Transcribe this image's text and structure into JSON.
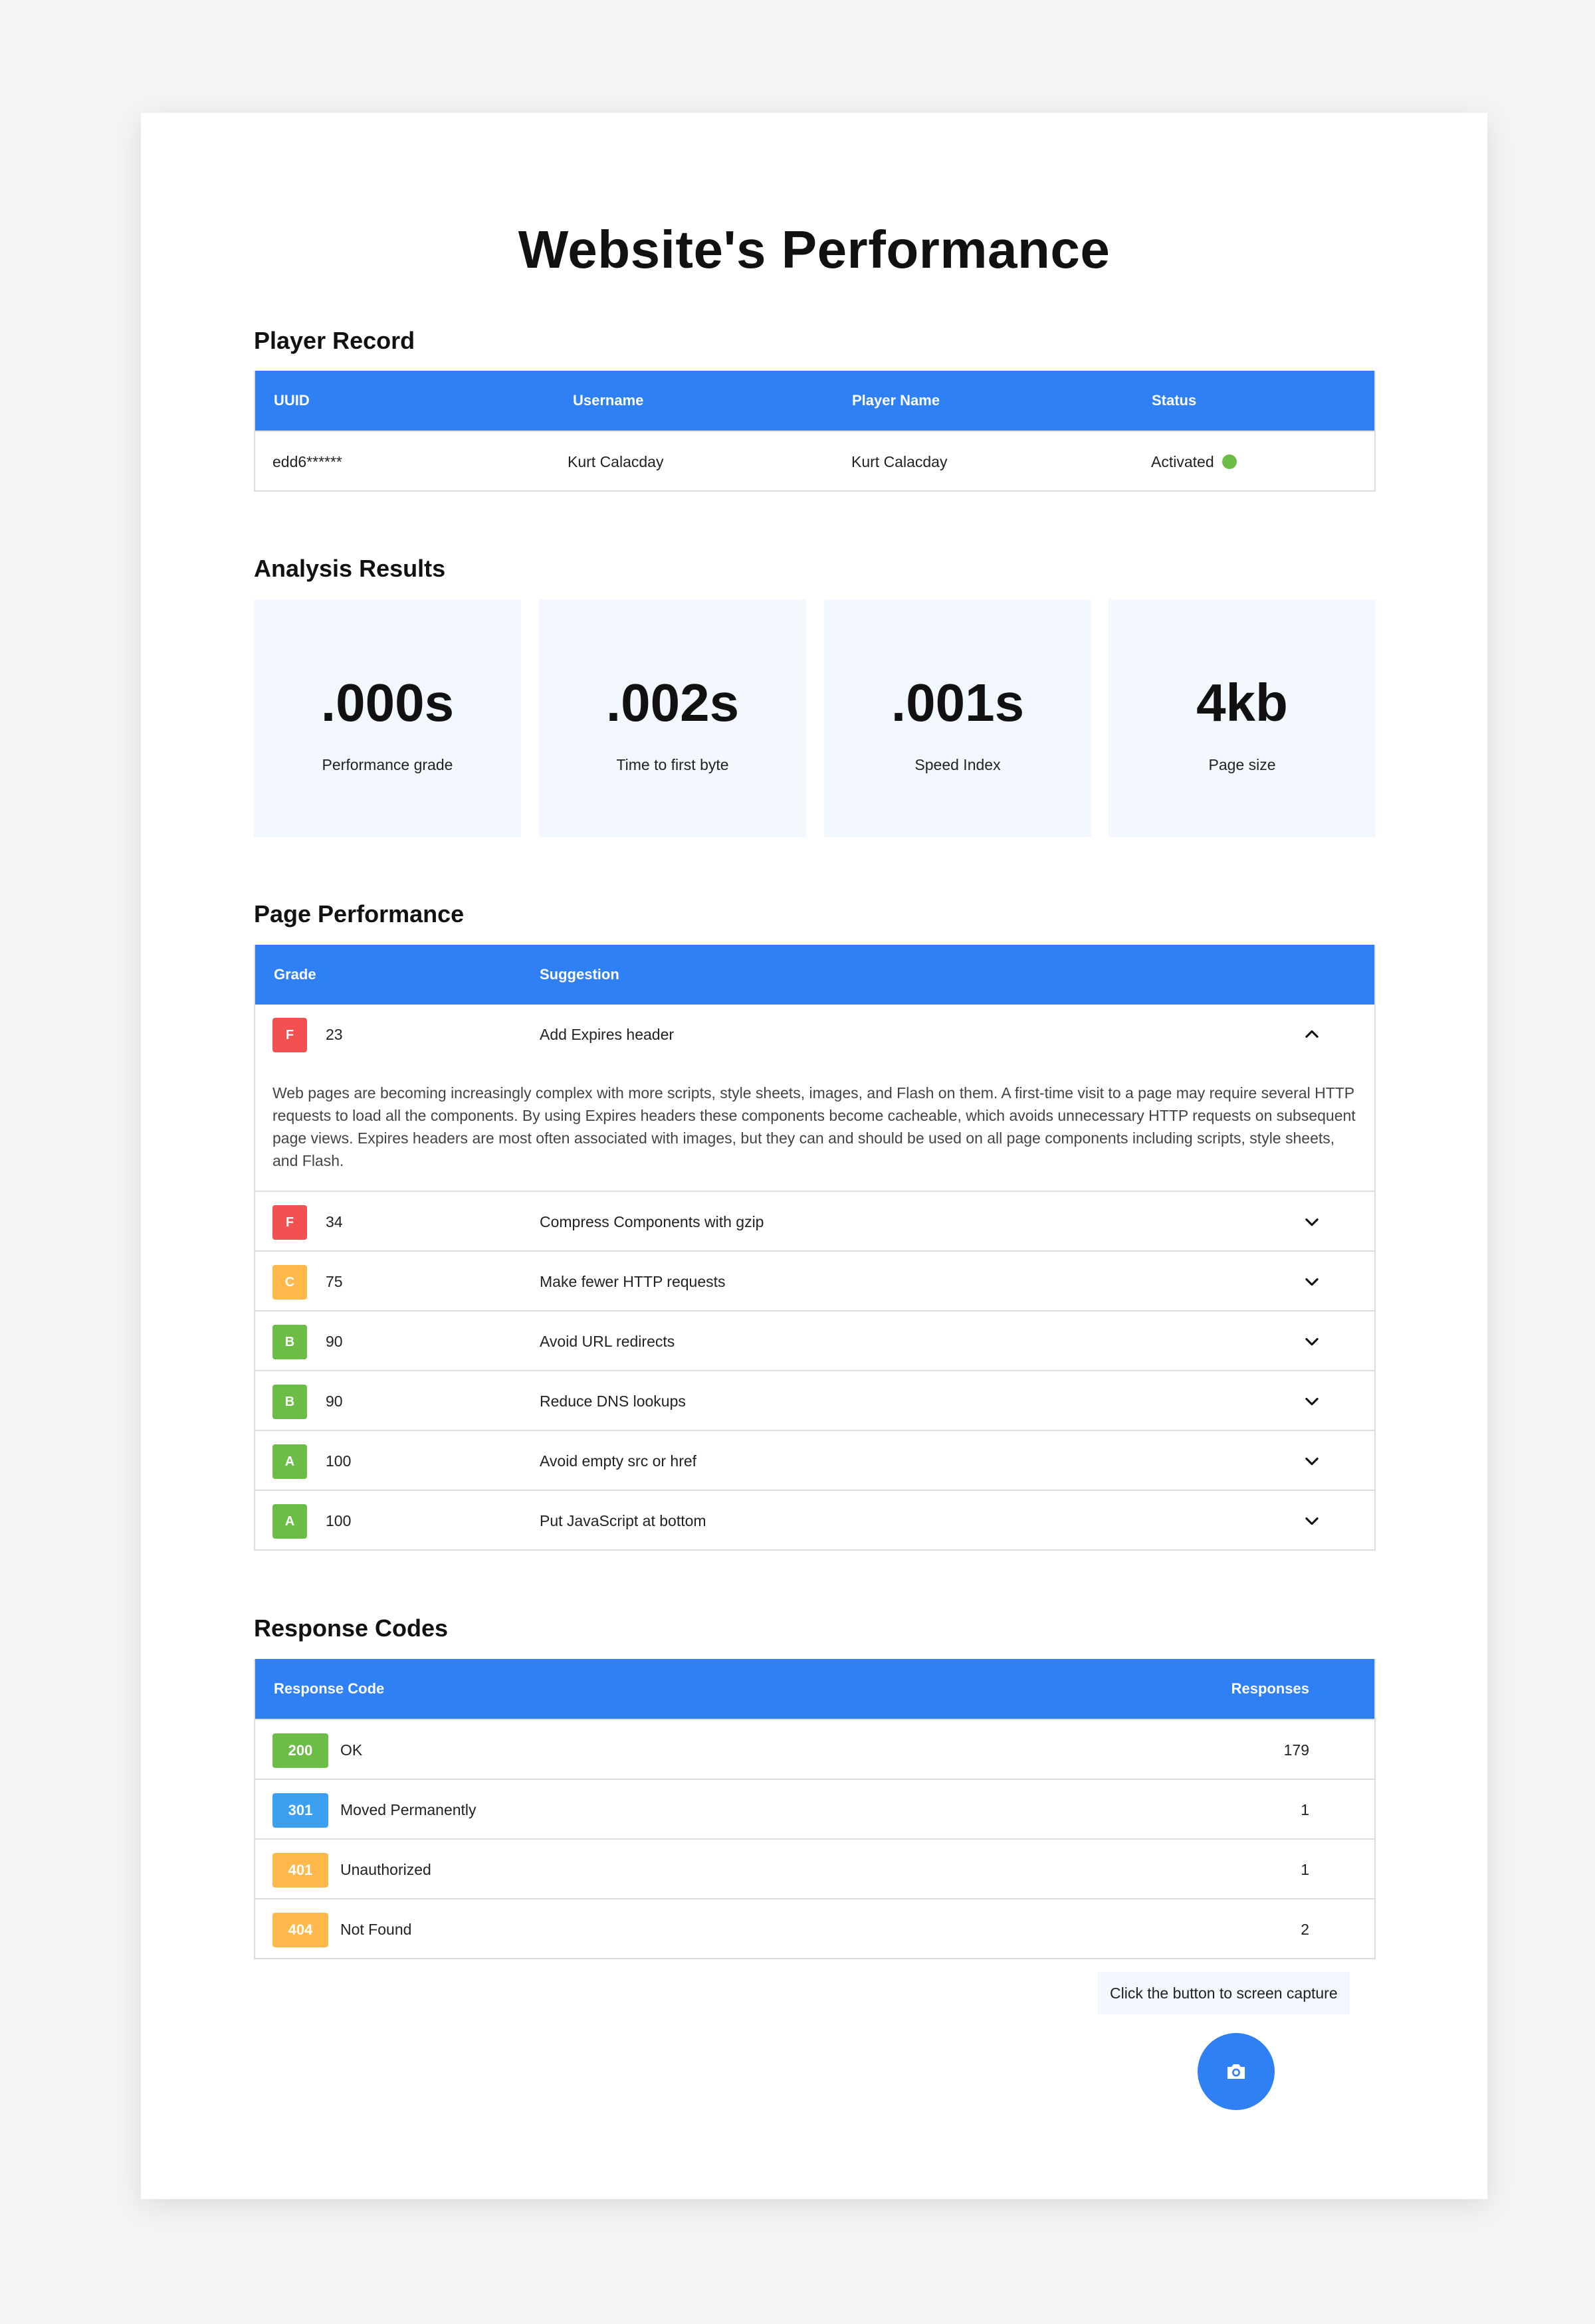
{
  "page": {
    "title": "Website's Performance"
  },
  "player_record": {
    "title": "Player Record",
    "headers": {
      "uuid": "UUID",
      "username": "Username",
      "player_name": "Player Name",
      "status": "Status"
    },
    "row": {
      "uuid": "edd6******",
      "username": "Kurt Calacday",
      "player_name": "Kurt Calacday",
      "status": "Activated"
    }
  },
  "analysis": {
    "title": "Analysis Results",
    "cards": [
      {
        "value": ".000s",
        "label": "Performance grade"
      },
      {
        "value": ".002s",
        "label": "Time to first byte"
      },
      {
        "value": ".001s",
        "label": "Speed Index"
      },
      {
        "value": "4kb",
        "label": "Page size"
      }
    ]
  },
  "page_performance": {
    "title": "Page Performance",
    "headers": {
      "grade": "Grade",
      "suggestion": "Suggestion"
    },
    "rows": [
      {
        "grade": "F",
        "score": "23",
        "suggestion": "Add Expires header",
        "expanded": true,
        "description": "Web pages are becoming increasingly complex with more scripts, style sheets, images, and Flash on them. A first-time visit to a page may require several HTTP requests to load all the components. By using Expires headers these components become cacheable, which avoids unnecessary HTTP requests on subsequent page views. Expires headers are most often associated with images, but they can and should be used on all page components including scripts, style sheets, and Flash."
      },
      {
        "grade": "F",
        "score": "34",
        "suggestion": "Compress Components with gzip"
      },
      {
        "grade": "C",
        "score": "75",
        "suggestion": "Make fewer HTTP requests"
      },
      {
        "grade": "B",
        "score": "90",
        "suggestion": "Avoid URL redirects"
      },
      {
        "grade": "B",
        "score": "90",
        "suggestion": "Reduce DNS lookups"
      },
      {
        "grade": "A",
        "score": "100",
        "suggestion": "Avoid empty src or href"
      },
      {
        "grade": "A",
        "score": "100",
        "suggestion": "Put JavaScript at bottom"
      }
    ]
  },
  "response_codes": {
    "title": "Response Codes",
    "headers": {
      "code": "Response Code",
      "responses": "Responses"
    },
    "rows": [
      {
        "code": "200",
        "label": "OK",
        "responses": "179"
      },
      {
        "code": "301",
        "label": "Moved Permanently",
        "responses": "1"
      },
      {
        "code": "401",
        "label": "Unauthorized",
        "responses": "1"
      },
      {
        "code": "404",
        "label": "Not Found",
        "responses": "2"
      }
    ]
  },
  "capture": {
    "hint": "Click the button to screen capture",
    "icon": "camera-icon"
  },
  "colors": {
    "accent": "#2f80f5",
    "grade_F": "#f25151",
    "grade_C": "#ffb84a",
    "grade_B": "#6cbd45",
    "grade_A": "#6cbd45",
    "code_200": "#6cbd45",
    "code_301": "#3b9ff2",
    "code_401": "#ffb84a",
    "code_404": "#ffb84a",
    "status_active": "#6cbd45"
  }
}
